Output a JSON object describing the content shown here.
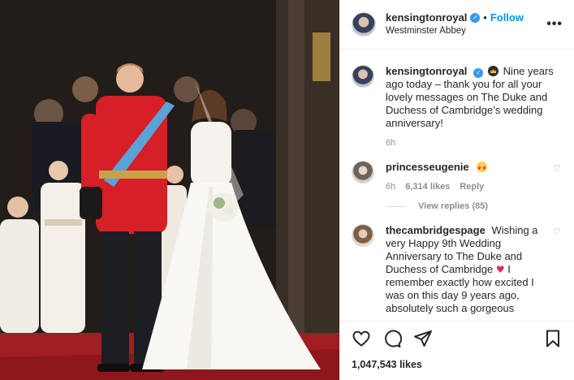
{
  "post": {
    "author": "kensingtonroyal",
    "follow_label": "Follow",
    "location": "Westminster Abbey",
    "more_label": "•••"
  },
  "caption": {
    "username": "kensingtonroyal",
    "text": "Nine years ago today – thank you for all your lovely messages on The Duke and Duchess of Cambridge’s wedding anniversary!",
    "time": "6h"
  },
  "comments": [
    {
      "username": "princesseugenie",
      "time": "6h",
      "likes": "6,314 likes",
      "reply_label": "Reply",
      "view_replies": "View replies (85)"
    },
    {
      "username": "thecambridgespage",
      "text_before": "Wishing a very Happy 9th Wedding Anniversary to The Duke and Duchess of Cambridge",
      "text_after": "I remember exactly how excited I was on this day 9 years ago, absolutely such a gorgeous"
    }
  ],
  "likes_total": "1,047,543 likes",
  "icons": {
    "like": "heart-icon",
    "comment": "comment-icon",
    "share": "share-icon",
    "save": "bookmark-icon",
    "crown_emoji": "crown-emoji",
    "heart_eyes_emoji": "heart-eyes-emoji",
    "red_heart_emoji": "red-heart-emoji"
  },
  "colors": {
    "link_blue": "#0095f6",
    "verified_blue": "#3897f0",
    "muted": "#8e8e8e"
  }
}
